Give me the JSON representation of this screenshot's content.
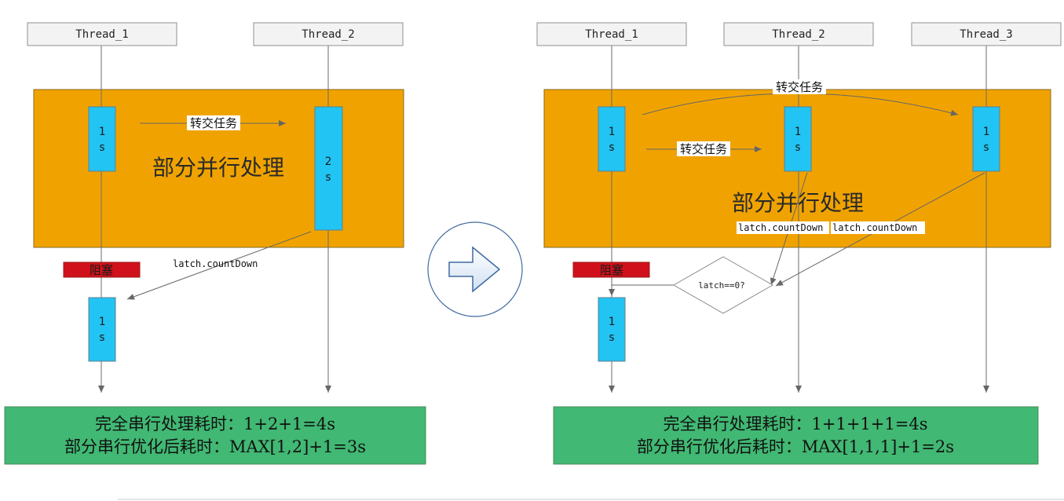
{
  "left": {
    "threads": [
      "Thread_1",
      "Thread_2"
    ],
    "tasks": [
      "1 s",
      "2 s",
      "1 s"
    ],
    "region_title": "部分并行处理",
    "handoff_label": "转交任务",
    "latch_label": "latch.countDown",
    "blocked_label": "阻塞",
    "summary_line1": "完全串行处理耗时：1+2+1=4s",
    "summary_line2": "部分串行优化后耗时：MAX[1,2]+1=3s"
  },
  "right": {
    "threads": [
      "Thread_1",
      "Thread_2",
      "Thread_3"
    ],
    "tasks": [
      "1 s",
      "1 s",
      "1 s",
      "1 s"
    ],
    "region_title": "部分并行处理",
    "handoff_label_top": "转交任务",
    "handoff_label_mid": "转交任务",
    "latch_label_a": "latch.countDown",
    "latch_label_b": "latch.countDown",
    "decision_label": "latch==0?",
    "blocked_label": "阻塞",
    "summary_line1": "完全串行处理耗时：1+1+1+1=4s",
    "summary_line2": "部分串行优化后耗时：MAX[1,1,1]+1=2s"
  },
  "transition_icon": "right-arrow-icon",
  "colors": {
    "region": "#f0a300",
    "task": "#21c4f3",
    "blocked": "#d0111b",
    "summary": "#41b873"
  }
}
